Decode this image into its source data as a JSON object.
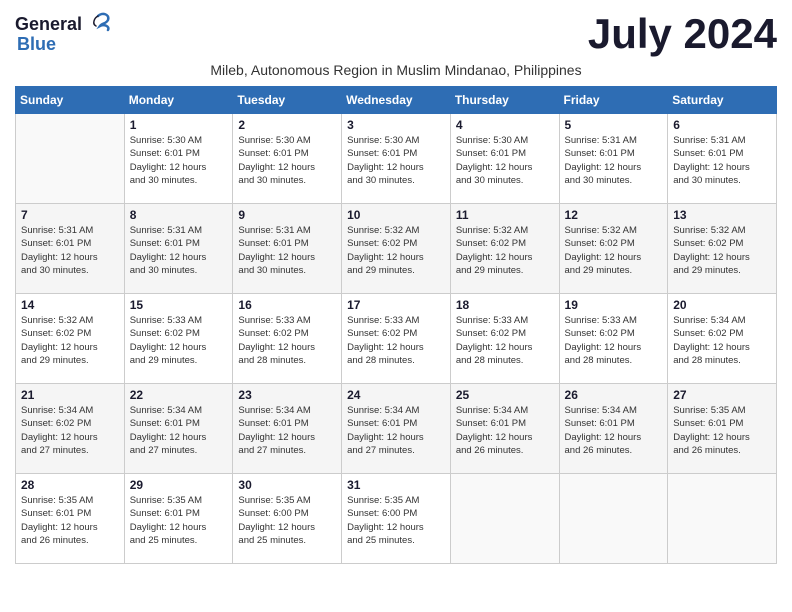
{
  "header": {
    "logo_general": "General",
    "logo_blue": "Blue",
    "month_year": "July 2024",
    "subtitle": "Mileb, Autonomous Region in Muslim Mindanao, Philippines"
  },
  "days_of_week": [
    "Sunday",
    "Monday",
    "Tuesday",
    "Wednesday",
    "Thursday",
    "Friday",
    "Saturday"
  ],
  "weeks": [
    [
      {
        "day": "",
        "info": ""
      },
      {
        "day": "1",
        "info": "Sunrise: 5:30 AM\nSunset: 6:01 PM\nDaylight: 12 hours\nand 30 minutes."
      },
      {
        "day": "2",
        "info": "Sunrise: 5:30 AM\nSunset: 6:01 PM\nDaylight: 12 hours\nand 30 minutes."
      },
      {
        "day": "3",
        "info": "Sunrise: 5:30 AM\nSunset: 6:01 PM\nDaylight: 12 hours\nand 30 minutes."
      },
      {
        "day": "4",
        "info": "Sunrise: 5:30 AM\nSunset: 6:01 PM\nDaylight: 12 hours\nand 30 minutes."
      },
      {
        "day": "5",
        "info": "Sunrise: 5:31 AM\nSunset: 6:01 PM\nDaylight: 12 hours\nand 30 minutes."
      },
      {
        "day": "6",
        "info": "Sunrise: 5:31 AM\nSunset: 6:01 PM\nDaylight: 12 hours\nand 30 minutes."
      }
    ],
    [
      {
        "day": "7",
        "info": "Sunrise: 5:31 AM\nSunset: 6:01 PM\nDaylight: 12 hours\nand 30 minutes."
      },
      {
        "day": "8",
        "info": "Sunrise: 5:31 AM\nSunset: 6:01 PM\nDaylight: 12 hours\nand 30 minutes."
      },
      {
        "day": "9",
        "info": "Sunrise: 5:31 AM\nSunset: 6:01 PM\nDaylight: 12 hours\nand 30 minutes."
      },
      {
        "day": "10",
        "info": "Sunrise: 5:32 AM\nSunset: 6:02 PM\nDaylight: 12 hours\nand 29 minutes."
      },
      {
        "day": "11",
        "info": "Sunrise: 5:32 AM\nSunset: 6:02 PM\nDaylight: 12 hours\nand 29 minutes."
      },
      {
        "day": "12",
        "info": "Sunrise: 5:32 AM\nSunset: 6:02 PM\nDaylight: 12 hours\nand 29 minutes."
      },
      {
        "day": "13",
        "info": "Sunrise: 5:32 AM\nSunset: 6:02 PM\nDaylight: 12 hours\nand 29 minutes."
      }
    ],
    [
      {
        "day": "14",
        "info": "Sunrise: 5:32 AM\nSunset: 6:02 PM\nDaylight: 12 hours\nand 29 minutes."
      },
      {
        "day": "15",
        "info": "Sunrise: 5:33 AM\nSunset: 6:02 PM\nDaylight: 12 hours\nand 29 minutes."
      },
      {
        "day": "16",
        "info": "Sunrise: 5:33 AM\nSunset: 6:02 PM\nDaylight: 12 hours\nand 28 minutes."
      },
      {
        "day": "17",
        "info": "Sunrise: 5:33 AM\nSunset: 6:02 PM\nDaylight: 12 hours\nand 28 minutes."
      },
      {
        "day": "18",
        "info": "Sunrise: 5:33 AM\nSunset: 6:02 PM\nDaylight: 12 hours\nand 28 minutes."
      },
      {
        "day": "19",
        "info": "Sunrise: 5:33 AM\nSunset: 6:02 PM\nDaylight: 12 hours\nand 28 minutes."
      },
      {
        "day": "20",
        "info": "Sunrise: 5:34 AM\nSunset: 6:02 PM\nDaylight: 12 hours\nand 28 minutes."
      }
    ],
    [
      {
        "day": "21",
        "info": "Sunrise: 5:34 AM\nSunset: 6:02 PM\nDaylight: 12 hours\nand 27 minutes."
      },
      {
        "day": "22",
        "info": "Sunrise: 5:34 AM\nSunset: 6:01 PM\nDaylight: 12 hours\nand 27 minutes."
      },
      {
        "day": "23",
        "info": "Sunrise: 5:34 AM\nSunset: 6:01 PM\nDaylight: 12 hours\nand 27 minutes."
      },
      {
        "day": "24",
        "info": "Sunrise: 5:34 AM\nSunset: 6:01 PM\nDaylight: 12 hours\nand 27 minutes."
      },
      {
        "day": "25",
        "info": "Sunrise: 5:34 AM\nSunset: 6:01 PM\nDaylight: 12 hours\nand 26 minutes."
      },
      {
        "day": "26",
        "info": "Sunrise: 5:34 AM\nSunset: 6:01 PM\nDaylight: 12 hours\nand 26 minutes."
      },
      {
        "day": "27",
        "info": "Sunrise: 5:35 AM\nSunset: 6:01 PM\nDaylight: 12 hours\nand 26 minutes."
      }
    ],
    [
      {
        "day": "28",
        "info": "Sunrise: 5:35 AM\nSunset: 6:01 PM\nDaylight: 12 hours\nand 26 minutes."
      },
      {
        "day": "29",
        "info": "Sunrise: 5:35 AM\nSunset: 6:01 PM\nDaylight: 12 hours\nand 25 minutes."
      },
      {
        "day": "30",
        "info": "Sunrise: 5:35 AM\nSunset: 6:00 PM\nDaylight: 12 hours\nand 25 minutes."
      },
      {
        "day": "31",
        "info": "Sunrise: 5:35 AM\nSunset: 6:00 PM\nDaylight: 12 hours\nand 25 minutes."
      },
      {
        "day": "",
        "info": ""
      },
      {
        "day": "",
        "info": ""
      },
      {
        "day": "",
        "info": ""
      }
    ]
  ]
}
